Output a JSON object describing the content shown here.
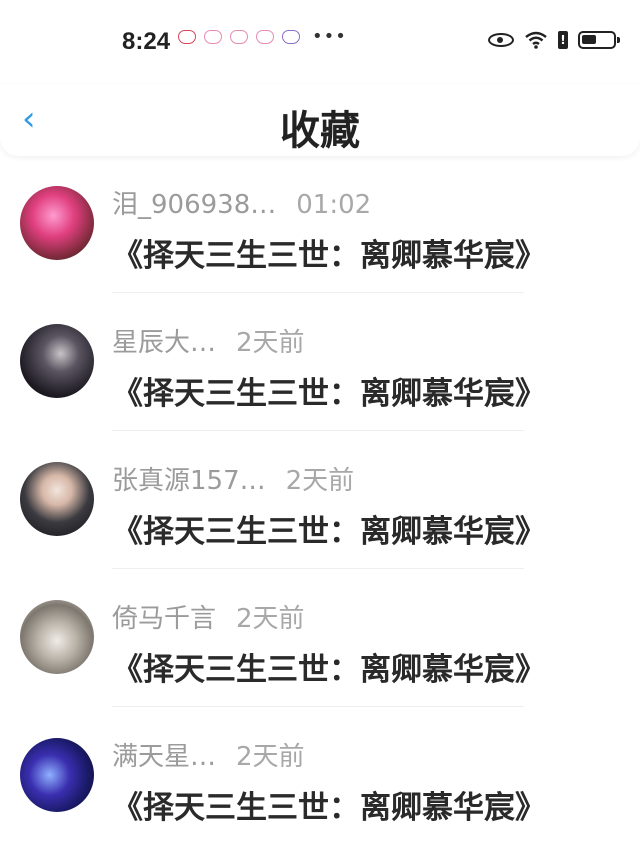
{
  "status_bar": {
    "time": "8:24",
    "notification_icons": [
      "heart-notif-icon",
      "heart-notif-icon",
      "heart-notif-icon",
      "heart-notif-icon",
      "heart-notif-icon"
    ],
    "more": "•••",
    "battery_warning": "!"
  },
  "header": {
    "back_icon": "‹",
    "title": "收藏"
  },
  "items": [
    {
      "user": "泪_906938…",
      "time": "01:02",
      "book": "《择天三生三世：离卿慕华宸》"
    },
    {
      "user": "星辰大…",
      "time": "2天前",
      "book": "《择天三生三世：离卿慕华宸》"
    },
    {
      "user": "张真源157…",
      "time": "2天前",
      "book": "《择天三生三世：离卿慕华宸》"
    },
    {
      "user": "倚马千言",
      "time": "2天前",
      "book": "《择天三生三世：离卿慕华宸》"
    },
    {
      "user": "满天星…",
      "time": "2天前",
      "book": "《择天三生三世：离卿慕华宸》"
    }
  ],
  "colors": {
    "accent": "#2f9be6",
    "meta_text": "#9b9b9b",
    "title_text": "#222222"
  }
}
